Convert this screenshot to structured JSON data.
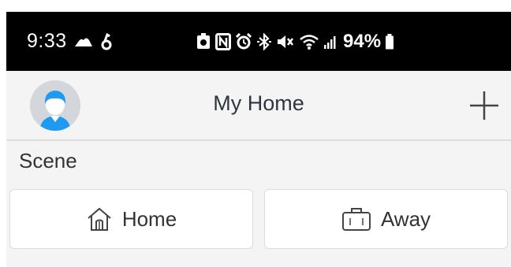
{
  "status_bar": {
    "time": "9:33",
    "battery": "94%",
    "left_icons": [
      "cloud-icon",
      "app-notification-icon"
    ],
    "right_icons": [
      "badge-icon",
      "nfc-icon",
      "alarm-icon",
      "bluetooth-icon",
      "mute-icon",
      "wifi-icon",
      "signal-icon",
      "battery-icon"
    ]
  },
  "header": {
    "title": "My Home",
    "avatar_icon": "user-avatar-icon",
    "add_icon": "plus-icon"
  },
  "scene": {
    "title": "Scene",
    "buttons": [
      {
        "label": "Home",
        "icon": "house-icon"
      },
      {
        "label": "Away",
        "icon": "briefcase-icon"
      }
    ]
  },
  "colors": {
    "status_bar_bg": "#000000",
    "header_bg": "#f4f4f4",
    "avatar_bg": "#d3d6da",
    "avatar_accent": "#1e9bf0",
    "text_primary": "#333333"
  }
}
